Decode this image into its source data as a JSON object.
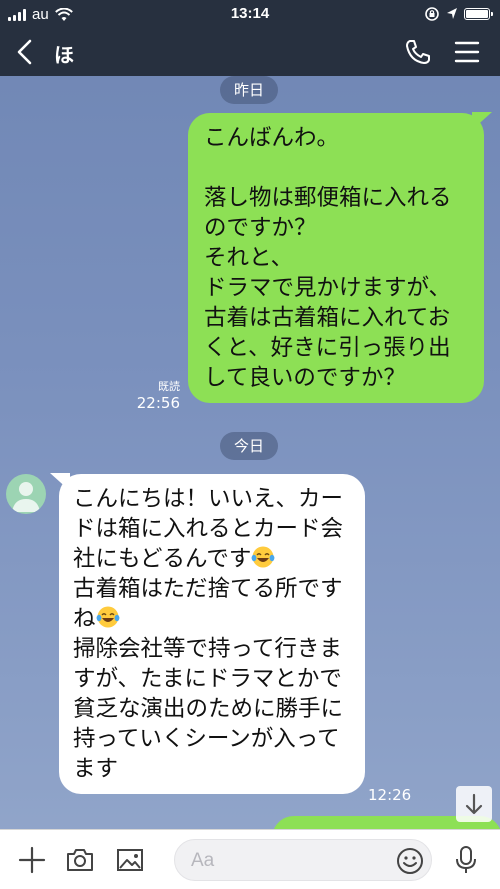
{
  "status_bar": {
    "carrier": "au",
    "time": "13:14"
  },
  "header": {
    "title": "ほ"
  },
  "messages": [
    {
      "date_separator": "昨日",
      "direction": "outgoing",
      "text": "こんばんわ。\n\n落し物は郵便箱に入れるのですか？\nそれと、\nドラマで見かけますが、古着は古着箱に入れておくと、好きに引っ張り出して良いのですか？",
      "read_label": "既読",
      "time": "22:56"
    },
    {
      "date_separator": "今日",
      "direction": "incoming",
      "text_parts": [
        "こんにちは！いいえ、カードは箱に入れるとカード会社にもどるんです",
        "古着箱はただ捨てる所ですね",
        "掃除会社等で持って行きますが、たまにドラマとかで貧乏な演出のために勝手に持っていくシーンが入ってます"
      ],
      "emoji": "face-with-tears-of-joy",
      "time": "12:26"
    }
  ],
  "input": {
    "placeholder": "Aa",
    "value": ""
  },
  "colors": {
    "header_bg": "#27303f",
    "outgoing_bubble": "#8de055",
    "incoming_bubble": "#ffffff",
    "chat_bg": "#7a90bd"
  },
  "icons": {
    "status_left": [
      "signal-icon",
      "wifi-icon"
    ],
    "status_right": [
      "rotation-lock-icon",
      "location-icon",
      "battery-icon"
    ],
    "header": [
      "back-icon",
      "phone-icon",
      "menu-icon"
    ],
    "input_bar": [
      "plus-icon",
      "camera-icon",
      "image-icon",
      "emoji-icon",
      "microphone-icon"
    ],
    "scroll": "arrow-down-icon"
  }
}
